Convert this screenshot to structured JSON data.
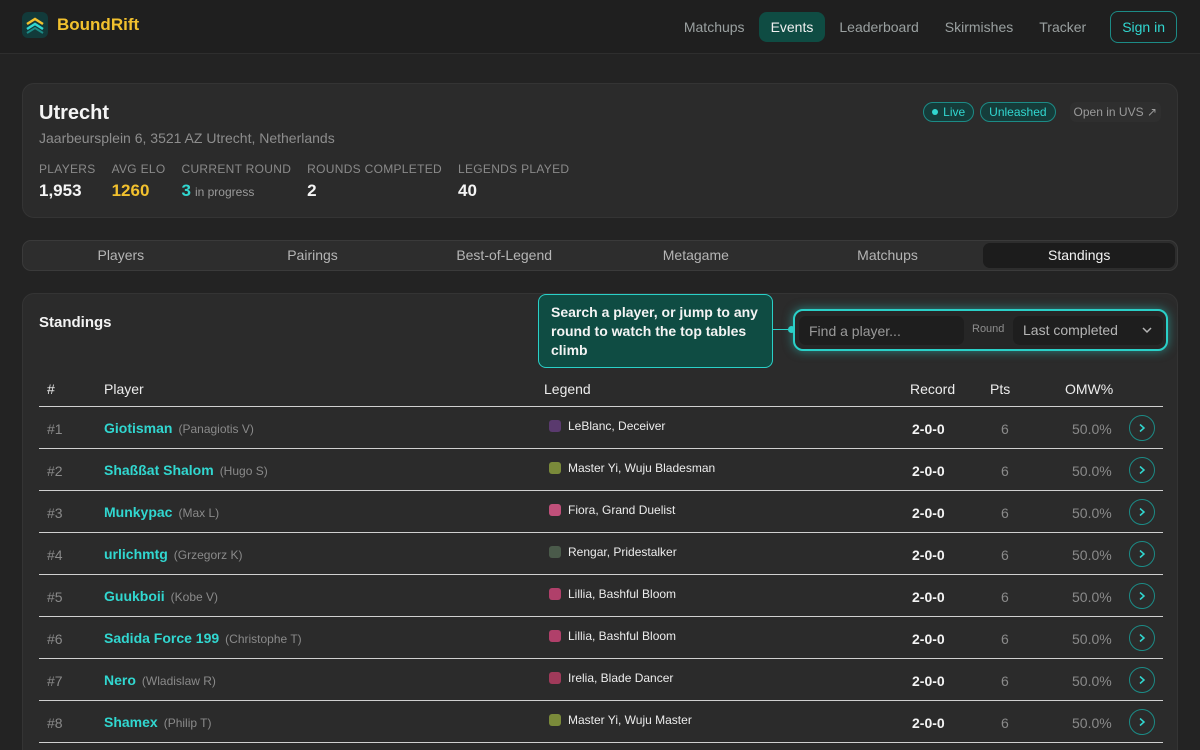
{
  "brand": {
    "name": "BoundRift",
    "logo_icon": "boundrift-logo-icon"
  },
  "nav": {
    "items": [
      {
        "label": "Matchups",
        "active": false
      },
      {
        "label": "Events",
        "active": true
      },
      {
        "label": "Leaderboard",
        "active": false
      },
      {
        "label": "Skirmishes",
        "active": false
      },
      {
        "label": "Tracker",
        "active": false
      }
    ],
    "signin_label": "Sign in"
  },
  "event": {
    "title": "Utrecht",
    "address": "Jaarbeursplein 6, 3521 AZ Utrecht, Netherlands",
    "badges": {
      "live": "Live",
      "format": "Unleashed"
    },
    "open_link": "Open in UVS",
    "stats": {
      "players_label": "PLAYERS",
      "players_value": "1,953",
      "elo_label": "AVG ELO",
      "elo_value": "1260",
      "round_label": "CURRENT ROUND",
      "round_value": "3",
      "round_sub": "in progress",
      "completed_label": "ROUNDS COMPLETED",
      "completed_value": "2",
      "legends_label": "LEGENDS PLAYED",
      "legends_value": "40"
    }
  },
  "tabs": [
    {
      "label": "Players",
      "active": false
    },
    {
      "label": "Pairings",
      "active": false
    },
    {
      "label": "Best-of-Legend",
      "active": false
    },
    {
      "label": "Metagame",
      "active": false
    },
    {
      "label": "Matchups",
      "active": false
    },
    {
      "label": "Standings",
      "active": true
    }
  ],
  "standings": {
    "title": "Standings",
    "tooltip": "Search a player, or jump to any round to watch the top tables climb",
    "search_placeholder": "Find a player...",
    "round_label": "Round",
    "round_value": "Last completed",
    "headers": {
      "rank": "#",
      "player": "Player",
      "legend": "Legend",
      "record": "Record",
      "pts": "Pts",
      "omw": "OMW%"
    },
    "rows": [
      {
        "rank": "#1",
        "player": "Giotisman",
        "real": "(Panagiotis V)",
        "legend": "LeBlanc, Deceiver",
        "legend_color": "#5a3a6e",
        "record": "2-0-0",
        "pts": "6",
        "omw": "50.0%"
      },
      {
        "rank": "#2",
        "player": "Shaßßat Shalom",
        "real": "(Hugo S)",
        "legend": "Master Yi, Wuju Bladesman",
        "legend_color": "#7a8a3a",
        "record": "2-0-0",
        "pts": "6",
        "omw": "50.0%"
      },
      {
        "rank": "#3",
        "player": "Munkypac",
        "real": "(Max L)",
        "legend": "Fiora, Grand Duelist",
        "legend_color": "#c0507a",
        "record": "2-0-0",
        "pts": "6",
        "omw": "50.0%"
      },
      {
        "rank": "#4",
        "player": "urlichmtg",
        "real": "(Grzegorz K)",
        "legend": "Rengar, Pridestalker",
        "legend_color": "#4a5a4a",
        "record": "2-0-0",
        "pts": "6",
        "omw": "50.0%"
      },
      {
        "rank": "#5",
        "player": "Guukboii",
        "real": "(Kobe V)",
        "legend": "Lillia, Bashful Bloom",
        "legend_color": "#b0406a",
        "record": "2-0-0",
        "pts": "6",
        "omw": "50.0%"
      },
      {
        "rank": "#6",
        "player": "Sadida Force 199",
        "real": "(Christophe T)",
        "legend": "Lillia, Bashful Bloom",
        "legend_color": "#b0406a",
        "record": "2-0-0",
        "pts": "6",
        "omw": "50.0%"
      },
      {
        "rank": "#7",
        "player": "Nero",
        "real": "(Wladislaw R)",
        "legend": "Irelia, Blade Dancer",
        "legend_color": "#a03a5a",
        "record": "2-0-0",
        "pts": "6",
        "omw": "50.0%"
      },
      {
        "rank": "#8",
        "player": "Shamex",
        "real": "(Philip T)",
        "legend": "Master Yi, Wuju Master",
        "legend_color": "#7a8a3a",
        "record": "2-0-0",
        "pts": "6",
        "omw": "50.0%"
      }
    ]
  },
  "colors": {
    "accent": "#31d7d0",
    "brand": "#f2c12e",
    "active_bg": "#0f4c43"
  }
}
